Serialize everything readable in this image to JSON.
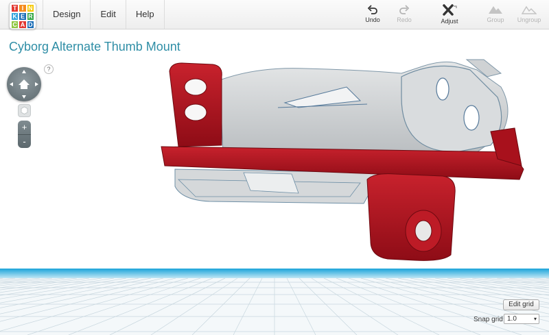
{
  "app": {
    "logo_letters": [
      "T",
      "I",
      "N",
      "K",
      "E",
      "R",
      "C",
      "A",
      "D"
    ],
    "logo_colors": [
      "#e23731",
      "#f58c1f",
      "#f6c800",
      "#2ea3dc",
      "#1d6fb8",
      "#35a746",
      "#8fc641",
      "#e23731",
      "#1d6fb8"
    ]
  },
  "menu": {
    "items": [
      {
        "label": "Design"
      },
      {
        "label": "Edit"
      },
      {
        "label": "Help"
      }
    ]
  },
  "toolbar": {
    "undo": "Undo",
    "redo": "Redo",
    "adjust": "Adjust",
    "group": "Group",
    "ungroup": "Ungroup"
  },
  "design": {
    "title": "Cyborg Alternate Thumb Mount"
  },
  "view": {
    "help_label": "?",
    "zoom_in": "+",
    "zoom_out": "-"
  },
  "grid": {
    "edit_label": "Edit grid",
    "snap_label": "Snap grid",
    "snap_value": "1.0"
  },
  "colors": {
    "accent": "#2f8ea6",
    "model_red": "#b0131f",
    "model_gray": "#cfd2d4",
    "plane_blue": "#1aa3d9"
  }
}
